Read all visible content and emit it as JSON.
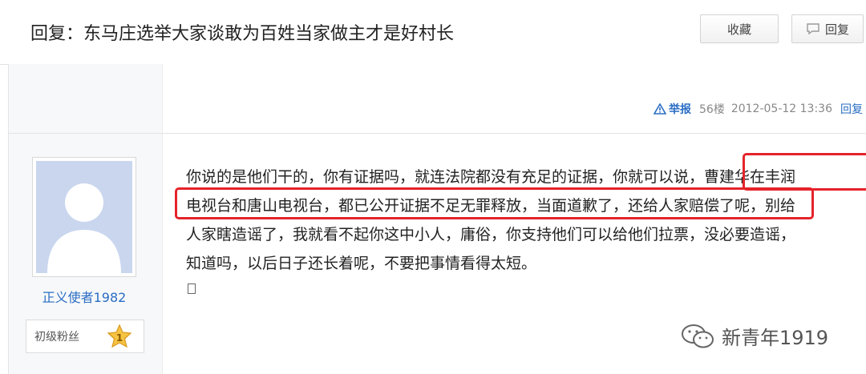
{
  "header": {
    "title": "回复：东马庄选举大家谈敢为百姓当家做主才是好村长",
    "favorite_label": "收藏",
    "reply_label": "回复"
  },
  "post": {
    "report_label": "举报",
    "floor": "56楼",
    "timestamp": "2012-05-12 13:36",
    "reply_link": "回复",
    "author": "正义使者1982",
    "rank": "初级粉丝",
    "rank_level": "1",
    "lines": [
      "你说的是他们干的，你有证据吗，就连法院都没有充足的证据，你就可以说，曹建华在丰润",
      "电视台和唐山电视台，都已公开证据不足无罪释放，当面道歉了，还给人家赔偿了呢，别给",
      "人家瞎造谣了，我就看不起你这中小人，庸俗，你支持他们可以给他们拉票，没必要造谣，",
      "知道吗，以后日子还长着呢，不要把事情看得太短。"
    ]
  },
  "watermark": "新青年1919",
  "colors": {
    "link": "#2a6dc4",
    "highlight": "#e5232b"
  }
}
